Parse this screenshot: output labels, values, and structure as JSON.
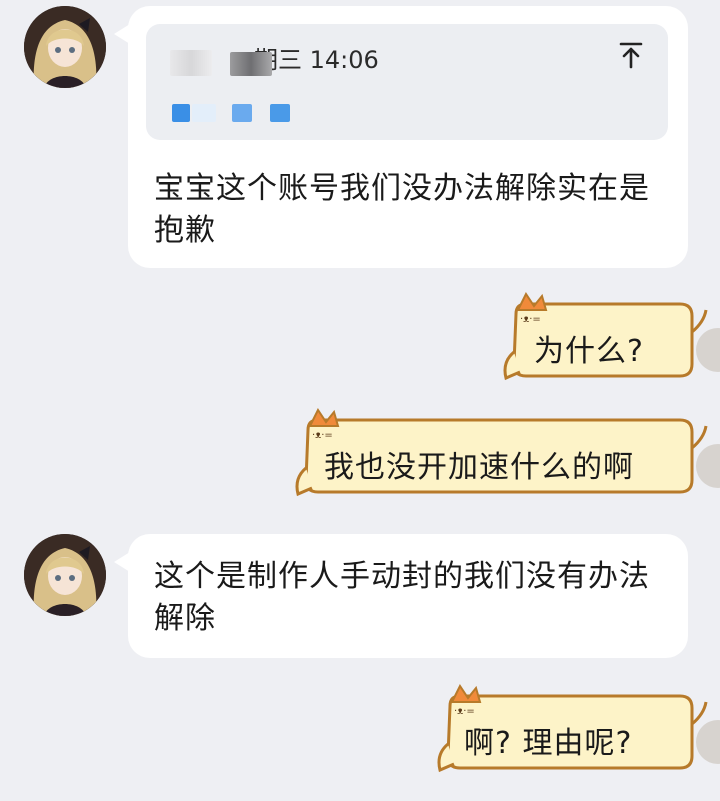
{
  "messages": [
    {
      "side": "left",
      "quote": {
        "author": "莫小",
        "time": "期三 14:06"
      },
      "text": "宝宝这个账号我们没办法解除实在是抱歉"
    },
    {
      "side": "right",
      "text": "为什么?"
    },
    {
      "side": "right",
      "text": "我也没开加速什么的啊"
    },
    {
      "side": "left",
      "text": "这个是制作人手动封的我们没有办法解除"
    },
    {
      "side": "right",
      "text": "啊? 理由呢?"
    }
  ],
  "icons": {
    "quote_jump": "arrow-up-to-top-icon",
    "avatar": "anime-girl-avatar"
  },
  "colors": {
    "background": "#eeeff3",
    "bubble_left": "#ffffff",
    "bubble_right": "#fdf3c8",
    "bubble_right_border": "#b77a2a",
    "blur_blue": "#4a9ae8"
  }
}
